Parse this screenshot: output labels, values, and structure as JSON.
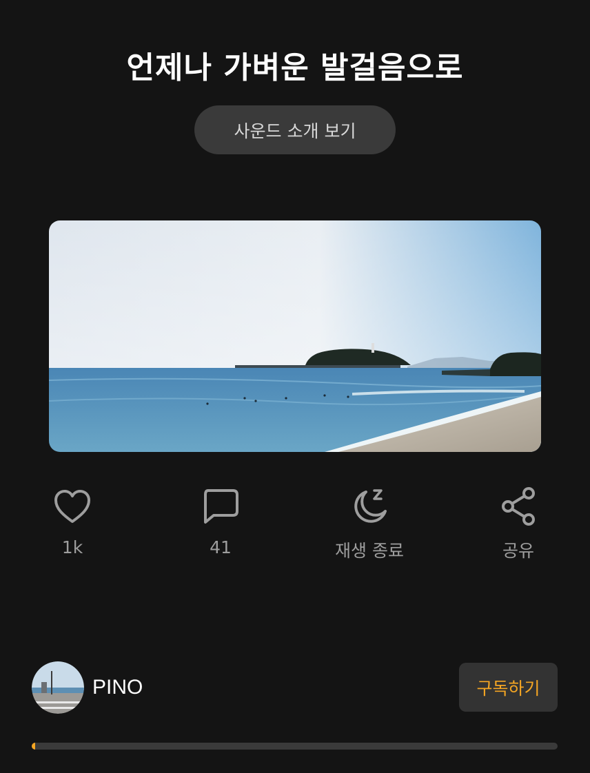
{
  "title": "언제나 가벼운 발걸음으로",
  "intro_button": "사운드 소개 보기",
  "cover_image": "seaside-beach-island-photo",
  "actions": [
    {
      "icon": "heart-icon",
      "label": "1k"
    },
    {
      "icon": "comment-icon",
      "label": "41"
    },
    {
      "icon": "sleep-timer-moon-icon",
      "label": "재생 종료"
    },
    {
      "icon": "share-icon",
      "label": "공유"
    }
  ],
  "author": {
    "name": "PINO",
    "avatar": "beach-street-avatar-photo"
  },
  "subscribe_button": "구독하기",
  "progress": {
    "fraction": 0.006
  },
  "colors": {
    "background": "#141414",
    "accent": "#f5a623",
    "button_bg": "#3a3a3a",
    "icon_gray": "#9e9e9e"
  }
}
